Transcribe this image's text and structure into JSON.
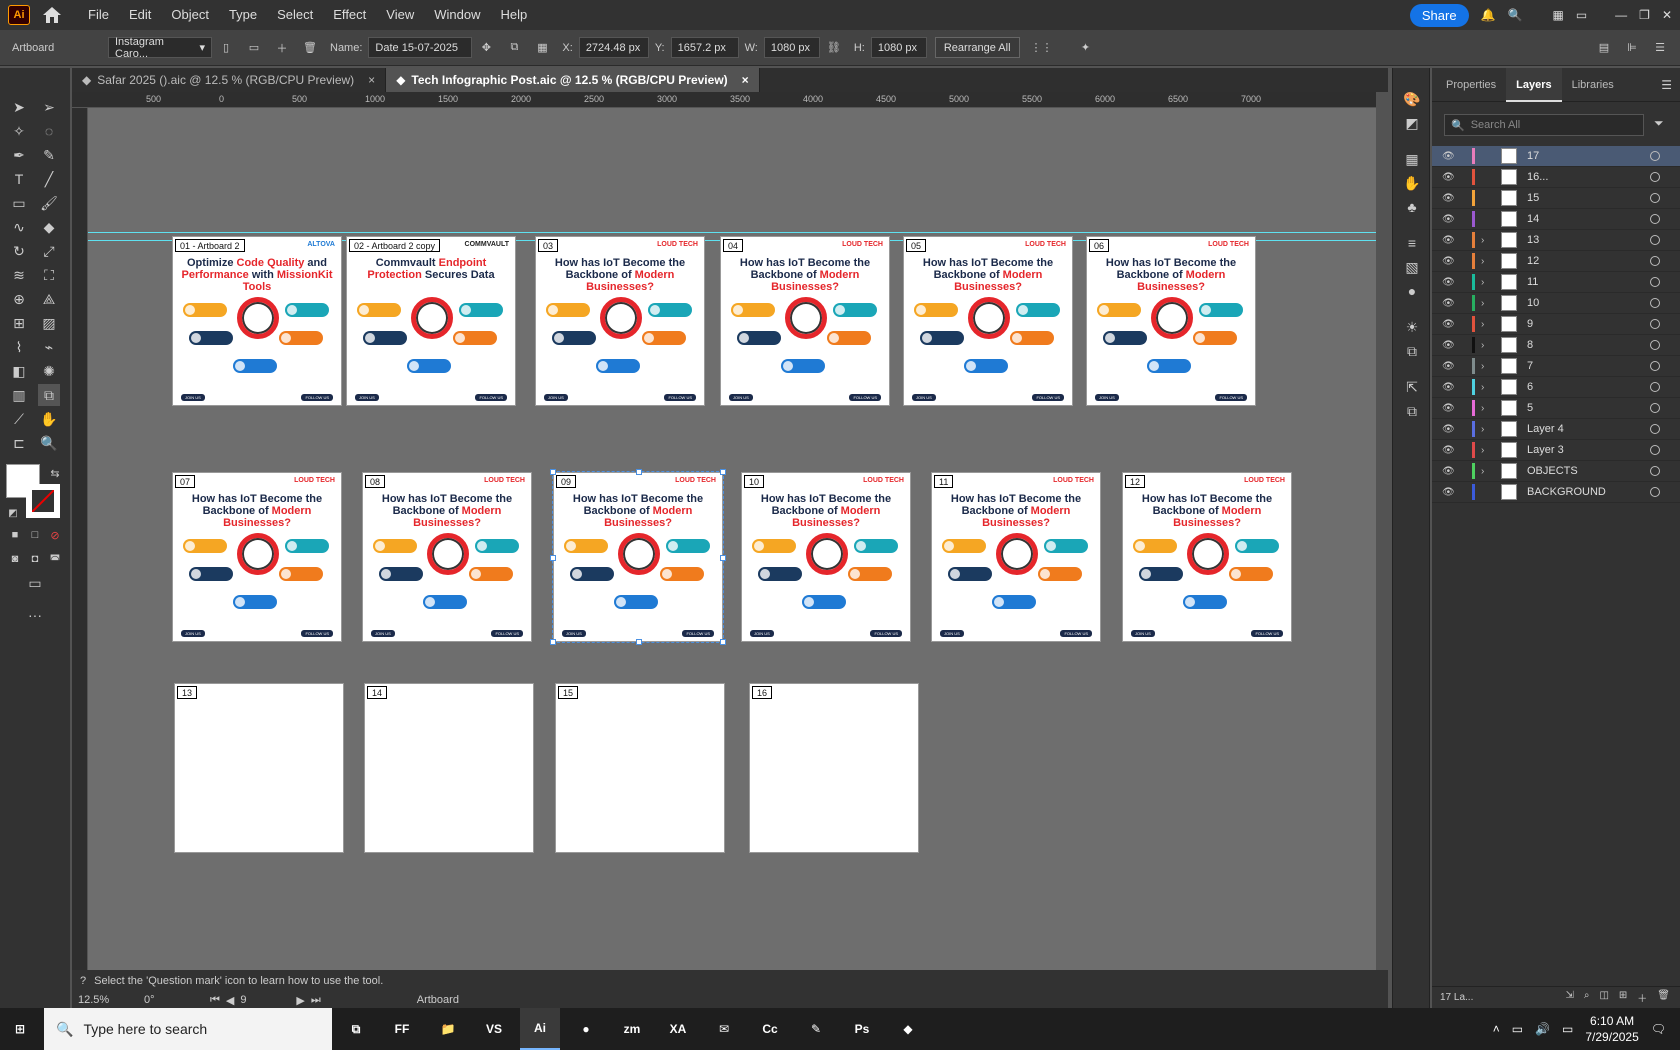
{
  "app": {
    "logo": "Ai",
    "menu": [
      "File",
      "Edit",
      "Object",
      "Type",
      "Select",
      "Effect",
      "View",
      "Window",
      "Help"
    ],
    "share_label": "Share"
  },
  "control": {
    "artboard_label": "Artboard",
    "preset": "Instagram Caro...",
    "name_label": "Name:",
    "name_value": "Date 15-07-2025",
    "x_label": "X:",
    "x_value": "2724.48 px",
    "y_label": "Y:",
    "y_value": "1657.2 px",
    "w_label": "W:",
    "w_value": "1080 px",
    "h_label": "H:",
    "h_value": "1080 px",
    "rearrange": "Rearrange All"
  },
  "tabs": [
    {
      "label": "Safar 2025 ().aic @ 12.5 % (RGB/CPU Preview)",
      "close": "×"
    },
    {
      "label": "Tech Infographic Post.aic @ 12.5 % (RGB/CPU Preview)",
      "close": "×"
    }
  ],
  "ruler_h": [
    "500",
    "0",
    "500",
    "1000",
    "1500",
    "2000",
    "2500",
    "3000",
    "3500",
    "4000",
    "4500",
    "5000",
    "5500",
    "6000",
    "6500",
    "7000"
  ],
  "artboards_row1": [
    {
      "label": "01 - Artboard 2",
      "brand": "ALTOVA",
      "t1": "Optimize ",
      "h1": "Code Quality",
      "t2": " and ",
      "h2": "Performance",
      "t3": " with ",
      "h3": "MissionKit Tools"
    },
    {
      "label": "02 - Artboard 2 copy",
      "brand": "COMMVAULT",
      "t1": "Commvault ",
      "h1": "Endpoint Protection",
      "t2": " Secures Data",
      "h2": "",
      "t3": "",
      "h3": ""
    },
    {
      "label": "03",
      "brand": "LOUD TECH",
      "t1": "How has IoT Become the Backbone of ",
      "h1": "Modern Businesses?",
      "t2": "",
      "h2": "",
      "t3": "",
      "h3": ""
    },
    {
      "label": "04",
      "brand": "LOUD TECH",
      "t1": "How has IoT Become the Backbone of ",
      "h1": "Modern Businesses?",
      "t2": "",
      "h2": "",
      "t3": "",
      "h3": ""
    },
    {
      "label": "05",
      "brand": "LOUD TECH",
      "t1": "How has IoT Become the Backbone of ",
      "h1": "Modern Businesses?",
      "t2": "",
      "h2": "",
      "t3": "",
      "h3": ""
    },
    {
      "label": "06",
      "brand": "LOUD TECH",
      "t1": "How has IoT Become the Backbone of ",
      "h1": "Modern Businesses?",
      "t2": "",
      "h2": "",
      "t3": "",
      "h3": ""
    }
  ],
  "artboards_row2": [
    {
      "label": "07"
    },
    {
      "label": "08"
    },
    {
      "label": "09"
    },
    {
      "label": "10"
    },
    {
      "label": "11"
    },
    {
      "label": "12"
    }
  ],
  "iot_board": {
    "brand": "LOUD TECH",
    "t1": "How has IoT Become the Backbone of ",
    "h1": "Modern Businesses?",
    "join": "JOIN US",
    "follow": "FOLLOW US"
  },
  "artboards_row3": [
    {
      "label": "13"
    },
    {
      "label": "14"
    },
    {
      "label": "15"
    },
    {
      "label": "16"
    }
  ],
  "panels": {
    "properties": "Properties",
    "layers": "Layers",
    "libraries": "Libraries",
    "search_placeholder": "Search All"
  },
  "layers": [
    {
      "name": "17",
      "color": "#e87dbb",
      "arrow": "",
      "selected": true
    },
    {
      "name": "16...",
      "color": "#e0533d",
      "arrow": ""
    },
    {
      "name": "15",
      "color": "#f2a33a",
      "arrow": ""
    },
    {
      "name": "14",
      "color": "#9b59d0",
      "arrow": ""
    },
    {
      "name": "13",
      "color": "#e57f3b",
      "arrow": "›"
    },
    {
      "name": "12",
      "color": "#e57f3b",
      "arrow": "›"
    },
    {
      "name": "11",
      "color": "#1abc9c",
      "arrow": "›"
    },
    {
      "name": "10",
      "color": "#27ae60",
      "arrow": "›"
    },
    {
      "name": "9",
      "color": "#e0533d",
      "arrow": "›"
    },
    {
      "name": "8",
      "color": "#111111",
      "arrow": "›"
    },
    {
      "name": "7",
      "color": "#7f8c8d",
      "arrow": "›"
    },
    {
      "name": "6",
      "color": "#4fd1e0",
      "arrow": "›"
    },
    {
      "name": "5",
      "color": "#e66bd7",
      "arrow": "›"
    },
    {
      "name": "Layer 4",
      "color": "#5a6ee0",
      "arrow": "›"
    },
    {
      "name": "Layer 3",
      "color": "#e04a4a",
      "arrow": "›"
    },
    {
      "name": "OBJECTS",
      "color": "#4ed160",
      "arrow": "›"
    },
    {
      "name": "BACKGROUND",
      "color": "#3b5bdb",
      "arrow": ""
    }
  ],
  "layers_footer": "17 La...",
  "status": {
    "hint": "Select the 'Question mark' icon to learn how to use the tool.",
    "zoom": "12.5%",
    "rotate": "0°",
    "artboard_num": "9",
    "mode": "Artboard"
  },
  "taskbar": {
    "search": "Type here to search",
    "time": "6:10 AM",
    "date": "7/29/2025",
    "apps": [
      "FF",
      "📁",
      "VS",
      "Ai",
      "●",
      "zm",
      "XA",
      "✉",
      "Cc",
      "✎",
      "Ps",
      "◆"
    ]
  }
}
